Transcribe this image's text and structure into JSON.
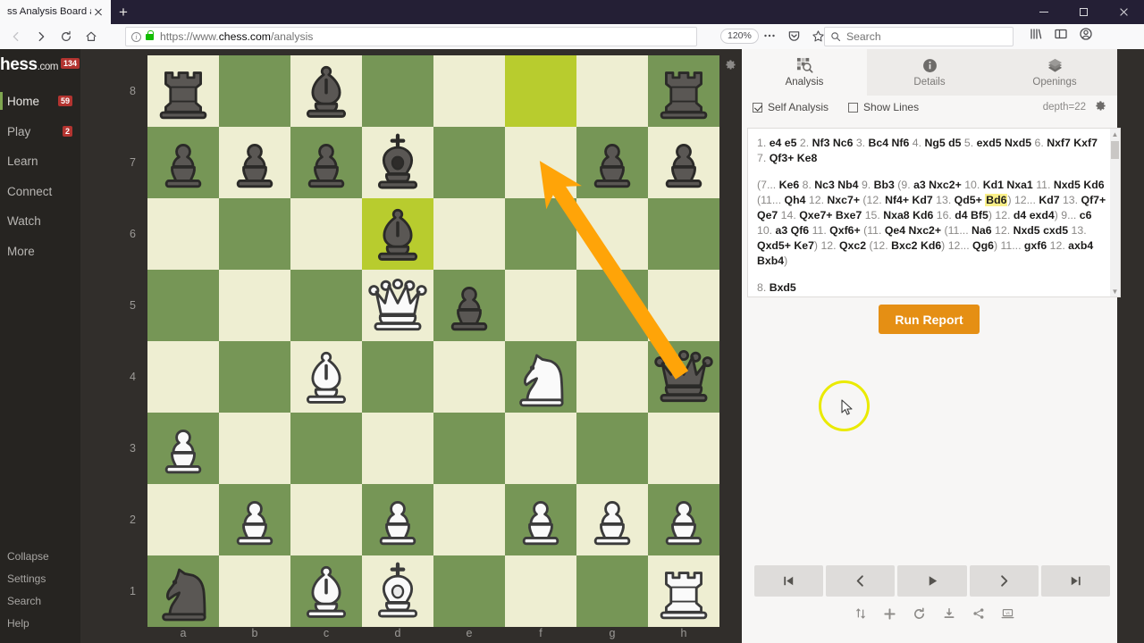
{
  "browser": {
    "tab_title": "ss Analysis Board and PGN",
    "new_tab_label": "+",
    "url_protocol": "https://www.",
    "url_domain": "chess.com",
    "url_path": "/analysis",
    "zoom_level": "120%",
    "search_placeholder": "Search",
    "icons": {
      "back": "back-arrow-icon",
      "forward": "forward-arrow-icon",
      "reload": "reload-icon",
      "home": "home-icon",
      "identity": "site-info-icon",
      "lock": "padlock-icon",
      "menu": "overflow-menu-icon",
      "pocket": "save-to-pocket-icon",
      "bookmark": "bookmark-star-icon",
      "library": "library-icon",
      "sidebar": "sidebar-toggle-icon",
      "account": "account-icon"
    },
    "window": {
      "minimize": "minimize",
      "maximize": "maximize",
      "close": "close"
    }
  },
  "sidebar": {
    "brand_name": "hess",
    "brand_suffix": ".com",
    "brand_badge": "134",
    "items": [
      {
        "label": "Home",
        "badge": "59",
        "active": true
      },
      {
        "label": "Play",
        "badge": "2",
        "active": false
      },
      {
        "label": "Learn",
        "badge": "",
        "active": false
      },
      {
        "label": "Connect",
        "badge": "",
        "active": false
      },
      {
        "label": "Watch",
        "badge": "",
        "active": false
      },
      {
        "label": "More",
        "badge": "",
        "active": false
      }
    ],
    "footer_items": [
      {
        "label": "Collapse"
      },
      {
        "label": "Settings"
      },
      {
        "label": "Search"
      },
      {
        "label": "Help"
      }
    ]
  },
  "board": {
    "rank_labels": [
      "8",
      "7",
      "6",
      "5",
      "4",
      "3",
      "2",
      "1"
    ],
    "file_labels": [
      "a",
      "b",
      "c",
      "d",
      "e",
      "f",
      "g",
      "h"
    ],
    "orientation": "white",
    "colors": {
      "light_square": "#eeeed2",
      "dark_square": "#769656",
      "highlight": "#b8cc2e",
      "arrow": "#ffa408"
    },
    "highlighted_squares": [
      "f8",
      "d6"
    ],
    "arrow": {
      "from": "h4",
      "to": "e7",
      "color": "#ffa408"
    },
    "pieces": [
      {
        "square": "a8",
        "piece": "black-rook"
      },
      {
        "square": "c8",
        "piece": "black-bishop"
      },
      {
        "square": "h8",
        "piece": "black-rook"
      },
      {
        "square": "a7",
        "piece": "black-pawn"
      },
      {
        "square": "b7",
        "piece": "black-pawn"
      },
      {
        "square": "c7",
        "piece": "black-pawn"
      },
      {
        "square": "d7",
        "piece": "black-king"
      },
      {
        "square": "g7",
        "piece": "black-pawn"
      },
      {
        "square": "h7",
        "piece": "black-pawn"
      },
      {
        "square": "d6",
        "piece": "black-bishop"
      },
      {
        "square": "d5",
        "piece": "white-queen"
      },
      {
        "square": "e5",
        "piece": "black-pawn"
      },
      {
        "square": "c4",
        "piece": "white-bishop"
      },
      {
        "square": "f4",
        "piece": "white-knight"
      },
      {
        "square": "h4",
        "piece": "black-queen"
      },
      {
        "square": "a3",
        "piece": "white-pawn"
      },
      {
        "square": "b2",
        "piece": "white-pawn"
      },
      {
        "square": "d2",
        "piece": "white-pawn"
      },
      {
        "square": "f2",
        "piece": "white-pawn"
      },
      {
        "square": "g2",
        "piece": "white-pawn"
      },
      {
        "square": "h2",
        "piece": "white-pawn"
      },
      {
        "square": "a1",
        "piece": "black-knight"
      },
      {
        "square": "c1",
        "piece": "white-bishop"
      },
      {
        "square": "d1",
        "piece": "white-king"
      },
      {
        "square": "h1",
        "piece": "white-rook"
      }
    ],
    "settings_icon": "gear-icon"
  },
  "panel": {
    "tabs": [
      {
        "label": "Analysis",
        "icon": "analysis-magnifier-icon",
        "active": true
      },
      {
        "label": "Details",
        "icon": "info-circle-icon",
        "active": false
      },
      {
        "label": "Openings",
        "icon": "books-icon",
        "active": false
      }
    ],
    "options": {
      "self_analysis_label": "Self Analysis",
      "self_analysis_checked": true,
      "show_lines_label": "Show Lines",
      "show_lines_checked": false,
      "depth_text": "depth=22",
      "settings_icon": "gear-icon"
    },
    "pgn": {
      "main_line_prefix": "1.",
      "main_line": "1. e4 e5 2. Nf3 Nc6 3. Bc4 Nf6 4. Ng5 d5 5. exd5 Nxd5 6. Nxf7 Kxf7 7. Qf3+ Ke8",
      "variation": "(7... Ke6 8. Nc3 Nb4 9. Bb3 (9. a3 Nxc2+ 10. Kd1 Nxa1 11. Nxd5 Kd6 (11... Qh4 12. Nxc7+ (12. Nf4+ Kd7 13. Qd5+ Bd6) 12... Kd7 13. Qf7+ Qe7 14. Qxe7+ Bxe7 15. Nxa8 Kd6 16. d4 Bf5) 12. d4 exd4) 9... c6 10. a3 Qf6 11. Qxf6+ (11. Qe4 Nxc2+ (11... Na6 12. Nxd5 cxd5 13. Qxd5+ Ke7) 12. Qxc2 (12. Bxc2 Kd6) 12... Qg6) 11... gxf6 12. axb4 Bxb4)",
      "highlighted_move": "Bd6",
      "current_move": "8. Bxd5",
      "current_move_number": "8.",
      "current_move_san": "Bxd5"
    },
    "run_report_label": "Run Report",
    "nav_buttons": [
      {
        "name": "first-move",
        "glyph": "⏮"
      },
      {
        "name": "previous-move",
        "glyph": "‹"
      },
      {
        "name": "play",
        "glyph": "▶"
      },
      {
        "name": "next-move",
        "glyph": "›"
      },
      {
        "name": "last-move",
        "glyph": "⏭"
      }
    ],
    "tool_buttons": [
      {
        "name": "flip-board-icon"
      },
      {
        "name": "add-icon"
      },
      {
        "name": "refresh-icon"
      },
      {
        "name": "download-icon"
      },
      {
        "name": "share-icon"
      },
      {
        "name": "vs-computer-icon"
      }
    ]
  }
}
